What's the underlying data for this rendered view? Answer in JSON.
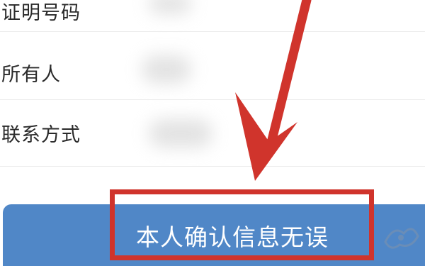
{
  "form": {
    "fields": [
      {
        "label": "证明号码"
      },
      {
        "label": "所有人"
      },
      {
        "label": "联系方式"
      }
    ]
  },
  "confirm_button": {
    "label": "本人确认信息无误"
  },
  "colors": {
    "button": "#5087c7",
    "highlight": "#d0342c",
    "arrow": "#d0342c"
  },
  "annotations": {
    "arrow_icon": "down-left-arrow-icon",
    "watermark_icon": "logo-watermark-icon"
  }
}
